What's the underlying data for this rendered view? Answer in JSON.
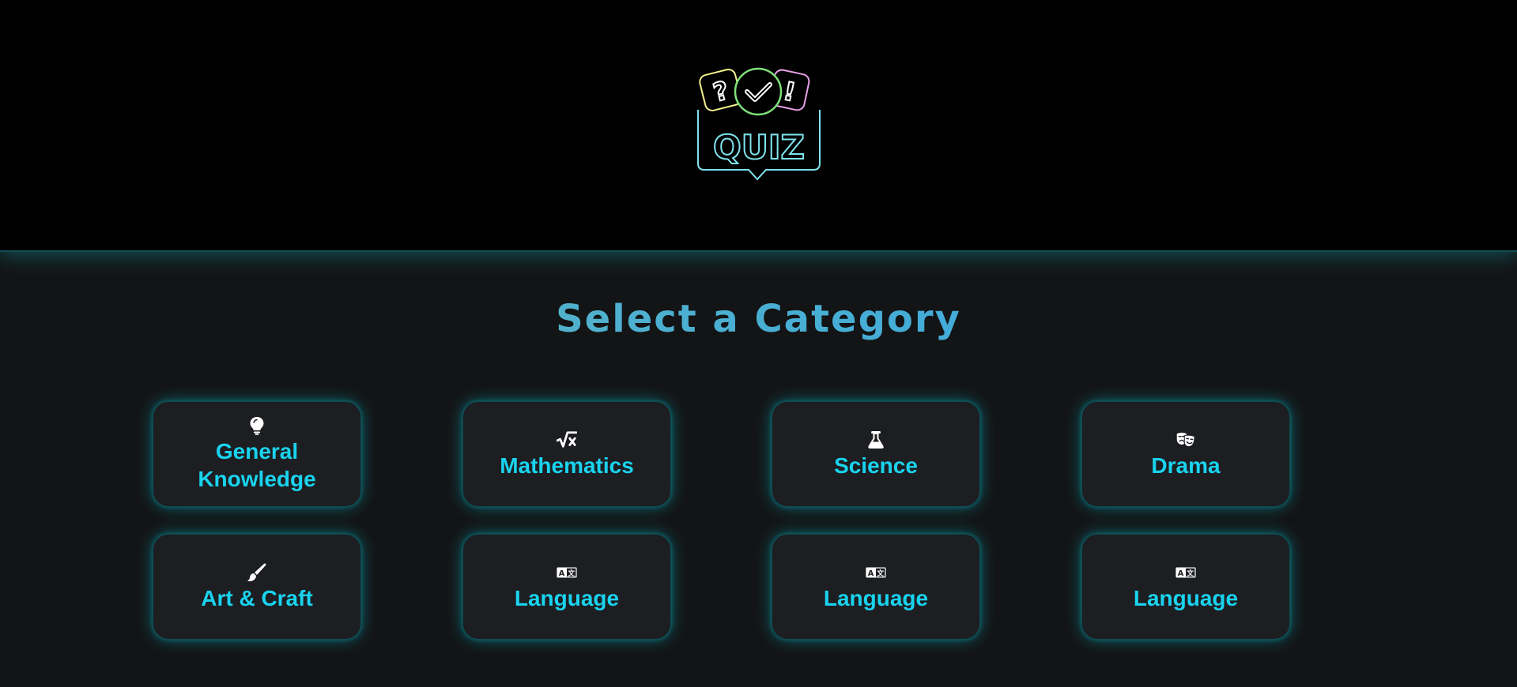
{
  "header": {
    "logo_text": "QUIZ",
    "logo_icon": "quiz-logo-icon"
  },
  "main": {
    "title": "Select a Category",
    "categories": [
      {
        "label": "General Knowledge",
        "icon": "lightbulb-icon"
      },
      {
        "label": "Mathematics",
        "icon": "square-root-icon"
      },
      {
        "label": "Science",
        "icon": "flask-icon"
      },
      {
        "label": "Drama",
        "icon": "masks-icon"
      },
      {
        "label": "Art & Craft",
        "icon": "paintbrush-icon"
      },
      {
        "label": "Language",
        "icon": "translate-icon"
      },
      {
        "label": "Language",
        "icon": "translate-icon"
      },
      {
        "label": "Language",
        "icon": "translate-icon"
      }
    ]
  },
  "colors": {
    "accent": "#19d3ef",
    "card_bg": "#1c1e21",
    "page_bg": "#131415",
    "header_bg": "#000000"
  }
}
